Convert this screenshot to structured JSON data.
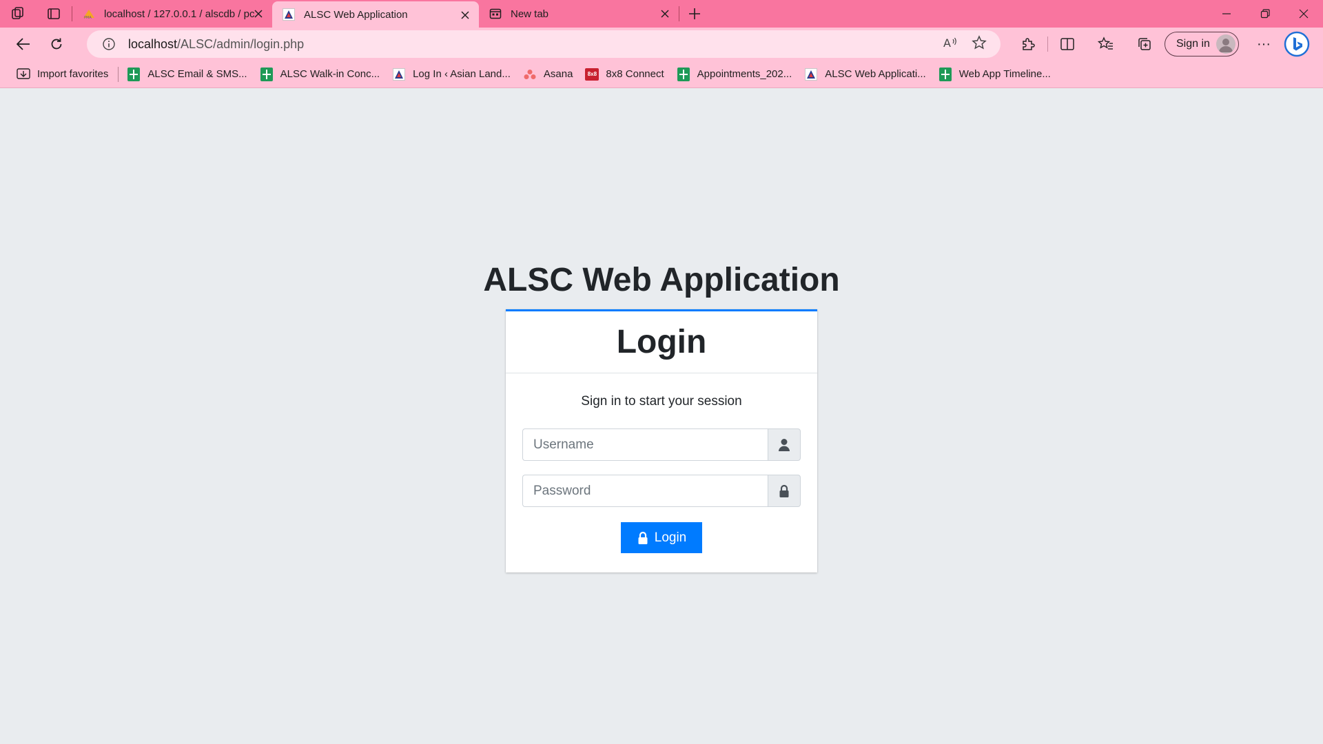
{
  "browser": {
    "tabs": [
      {
        "label": "localhost / 127.0.0.1 / alscdb / pc",
        "favicon": "phpmyadmin-icon",
        "active": false
      },
      {
        "label": "ALSC Web Application",
        "favicon": "alsc-logo-icon",
        "active": true
      },
      {
        "label": "New tab",
        "favicon": "new-tab-page-icon",
        "active": false
      }
    ],
    "address": {
      "host": "localhost",
      "path": "/ALSC/admin/login.php"
    },
    "signin_label": "Sign in",
    "favorites": [
      {
        "label": "Import favorites",
        "icon": "import-icon"
      },
      {
        "label": "ALSC Email & SMS...",
        "icon": "google-sheets-icon"
      },
      {
        "label": "ALSC Walk-in Conc...",
        "icon": "google-sheets-icon"
      },
      {
        "label": "Log In ‹ Asian Land...",
        "icon": "alsc-logo-icon"
      },
      {
        "label": "Asana",
        "icon": "asana-icon"
      },
      {
        "label": "8x8 Connect",
        "icon": "8x8-icon"
      },
      {
        "label": "Appointments_202...",
        "icon": "google-sheets-icon"
      },
      {
        "label": "ALSC Web Applicati...",
        "icon": "alsc-logo-icon"
      },
      {
        "label": "Web App Timeline...",
        "icon": "google-sheets-icon"
      }
    ],
    "colors": {
      "chrome": "#f9759f",
      "toolbar": "#ffc2d7"
    }
  },
  "page": {
    "app_title": "ALSC Web Application",
    "card_title": "Login",
    "message": "Sign in to start your session",
    "username_placeholder": "Username",
    "password_placeholder": "Password",
    "login_button": "Login",
    "colors": {
      "primary": "#007bff",
      "background": "#e9ecef"
    }
  }
}
